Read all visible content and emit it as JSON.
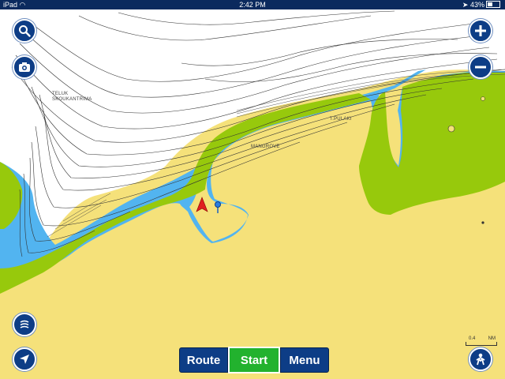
{
  "status_bar": {
    "device": "iPad",
    "time": "2:42 PM",
    "battery_percent": "43%",
    "battery_level": 0.43
  },
  "map": {
    "labels": {
      "bay": "TELUK\nSKOUKANTRIMA",
      "mangrove": "MANGROVE",
      "point": "T.PULAKI"
    },
    "scale": {
      "value": "0.4",
      "unit": "NM"
    },
    "colors": {
      "land": "#f5e17a",
      "vegetation": "#97c90c",
      "shallow_water": "#52b4f0",
      "deep_water": "#ffffff",
      "contour": "#333333"
    }
  },
  "controls": {
    "search_icon": "search-icon",
    "camera_icon": "camera-icon",
    "zoom_in_icon": "plus-icon",
    "zoom_out_icon": "minus-icon",
    "sonar_icon": "sonar-icon",
    "location_icon": "navigation-arrow-icon",
    "person_icon": "person-icon"
  },
  "toolbar": {
    "route_label": "Route",
    "start_label": "Start",
    "menu_label": "Menu"
  }
}
